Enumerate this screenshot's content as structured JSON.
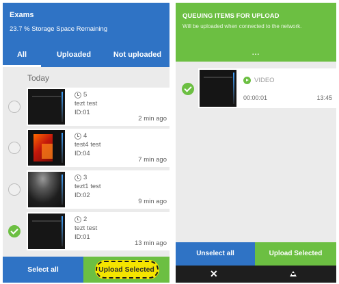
{
  "exams": {
    "title": "Exams",
    "storage": "23.7 % Storage Space Remaining",
    "tabs": [
      "All",
      "Uploaded",
      "Not uploaded"
    ],
    "active_tab": "All",
    "section": "Today",
    "items": [
      {
        "number": "5",
        "name": "tezt test",
        "id": "ID:01",
        "ago": "2 min ago",
        "selected": false
      },
      {
        "number": "4",
        "name": "test4 test",
        "id": "ID:04",
        "ago": "7 min ago",
        "selected": false
      },
      {
        "number": "3",
        "name": "tezt1 test",
        "id": "ID:02",
        "ago": "9 min ago",
        "selected": false
      },
      {
        "number": "2",
        "name": "tezt test",
        "id": "ID:01",
        "ago": "13 min ago",
        "selected": true
      }
    ],
    "buttons": {
      "select_all": "Select all",
      "upload_selected": "Upload Selected"
    }
  },
  "queue": {
    "title": "QUEUING ITEMS FOR UPLOAD",
    "subtitle": "Will be uploaded when connected to the network.",
    "more": "...",
    "item": {
      "type": "VIDEO",
      "duration": "00:00:01",
      "time": "13:45",
      "selected": true
    },
    "buttons": {
      "unselect_all": "Unselect all",
      "upload_selected": "Upload Selected"
    },
    "nav": {
      "close": "✕"
    }
  },
  "colors": {
    "blue": "#2f73c5",
    "green": "#6cbf42",
    "highlight": "#f5e400"
  }
}
